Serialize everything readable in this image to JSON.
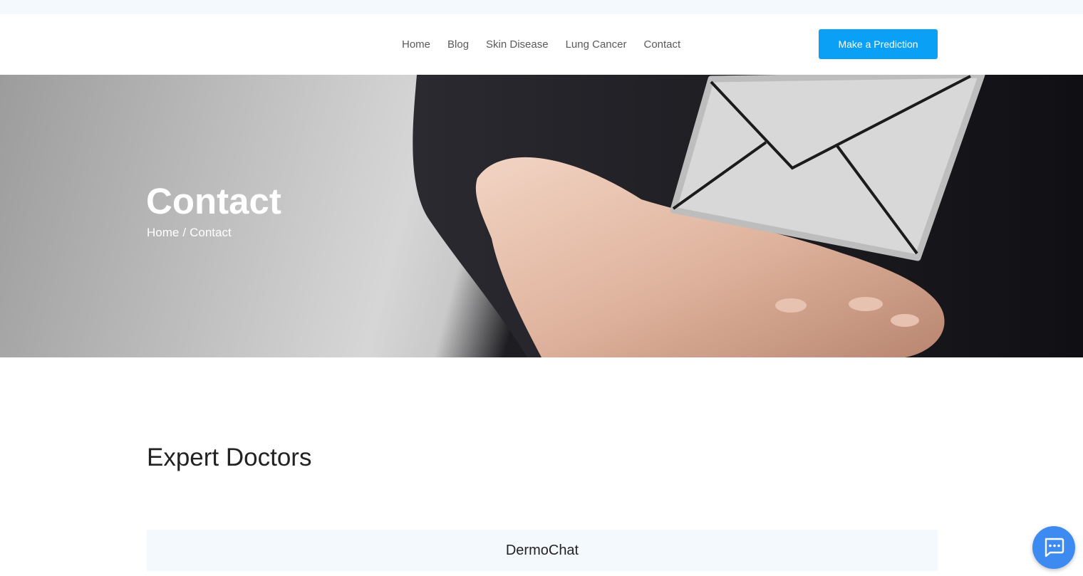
{
  "nav": {
    "links": [
      "Home",
      "Blog",
      "Skin Disease",
      "Lung Cancer",
      "Contact"
    ],
    "cta_label": "Make a Prediction"
  },
  "hero": {
    "title": "Contact",
    "breadcrumb": {
      "home": "Home",
      "separator": "/",
      "current": "Contact"
    }
  },
  "main": {
    "section_title": "Expert Doctors",
    "chat_panel_title": "DermoChat"
  },
  "icons": {
    "hero_image": "hand-holding-envelope-image",
    "chat_launcher": "chat-bubble-icon"
  },
  "colors": {
    "accent": "#0aa0f5",
    "chat_fab": "#3d8bf0",
    "panel_bg": "#f4f9fd"
  }
}
